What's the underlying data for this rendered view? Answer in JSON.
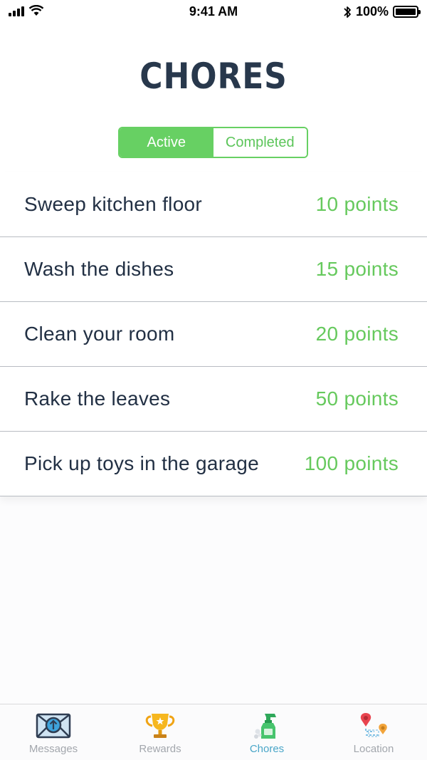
{
  "status_bar": {
    "time": "9:41 AM",
    "battery_percent": "100%"
  },
  "header": {
    "title": "CHORES"
  },
  "segmented_control": {
    "options": [
      "Active",
      "Completed"
    ],
    "selected": "Active"
  },
  "chores": [
    {
      "name": "Sweep kitchen floor",
      "points": "10 points"
    },
    {
      "name": "Wash the dishes",
      "points": "15 points"
    },
    {
      "name": "Clean your room",
      "points": "20 points"
    },
    {
      "name": "Rake the leaves",
      "points": "50 points"
    },
    {
      "name": "Pick up toys in the garage",
      "points": "100 points"
    }
  ],
  "tab_bar": {
    "tabs": [
      {
        "label": "Messages",
        "icon": "envelope-upload-icon"
      },
      {
        "label": "Rewards",
        "icon": "trophy-icon"
      },
      {
        "label": "Chores",
        "icon": "spray-bottle-icon"
      },
      {
        "label": "Location",
        "icon": "map-pins-icon"
      }
    ],
    "selected": "Chores"
  },
  "colors": {
    "accent_green": "#67d063",
    "title_navy": "#28384c",
    "tab_selected": "#4aa6c8",
    "tab_inactive": "#a3a7ad"
  }
}
